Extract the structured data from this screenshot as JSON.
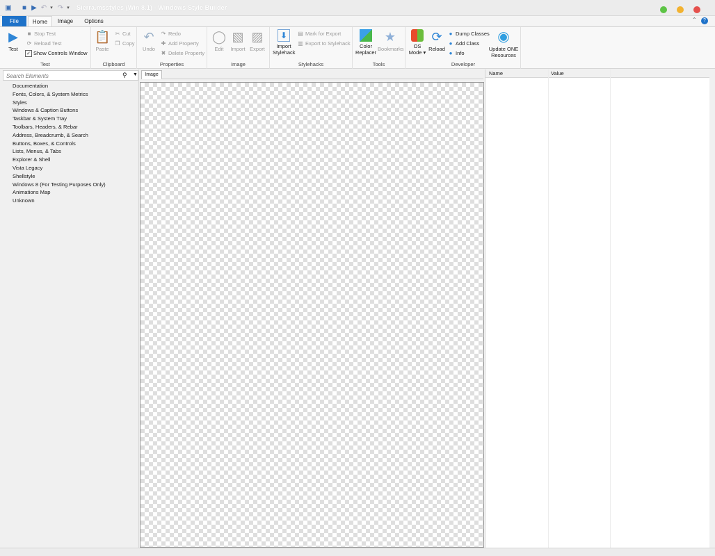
{
  "window": {
    "title": "Sierra.msstyles (Win 8.1) - Windows Style Builder",
    "colors": {
      "green": "#5dc445",
      "yellow": "#f2b230",
      "red": "#e5504c"
    }
  },
  "tabs": {
    "file": "File",
    "home": "Home",
    "image": "Image",
    "options": "Options"
  },
  "ribbon": {
    "test": {
      "label": "Test",
      "test_button": "Test",
      "stop_test": "Stop Test",
      "reload_test": "Reload Test",
      "show_controls_window": "Show Controls Window"
    },
    "clipboard": {
      "label": "Clipboard",
      "paste": "Paste",
      "cut": "Cut",
      "copy": "Copy"
    },
    "properties": {
      "label": "Properties",
      "undo": "Undo",
      "redo": "Redo",
      "add_property": "Add Property",
      "delete_property": "Delete Property"
    },
    "image": {
      "label": "Image",
      "edit": "Edit",
      "import": "Import",
      "export": "Export"
    },
    "stylehacks": {
      "label": "Stylehacks",
      "import_line1": "Import",
      "import_line2": "Stylehack",
      "mark_for_export": "Mark for Export",
      "export_to_stylehack": "Export to Stylehack"
    },
    "tools": {
      "label": "Tools",
      "color_line1": "Color",
      "color_line2": "Replacer",
      "bookmarks": "Bookmarks"
    },
    "developer": {
      "label": "Developer",
      "os_line1": "OS",
      "os_line2": "Mode",
      "reload": "Reload",
      "dump_classes": "Dump Classes",
      "add_class": "Add Class",
      "info": "Info",
      "update_line1": "Update ONE",
      "update_line2": "Resources"
    }
  },
  "search": {
    "placeholder": "Search Elements"
  },
  "tree": [
    "Documentation",
    "Fonts, Colors, & System Metrics",
    "Styles",
    "Windows & Caption Buttons",
    "Taskbar & System Tray",
    "Toolbars, Headers, & Rebar",
    "Address, Breadcrumb, & Search",
    "Buttons, Boxes, & Controls",
    "Lists, Menus, & Tabs",
    "Explorer & Shell",
    "Vista Legacy",
    "Shellstyle",
    "Windows 8 (For Testing Purposes Only)",
    "Animations Map",
    "Unknown"
  ],
  "doc_tab": "Image",
  "property_grid": {
    "name": "Name",
    "value": "Value"
  }
}
